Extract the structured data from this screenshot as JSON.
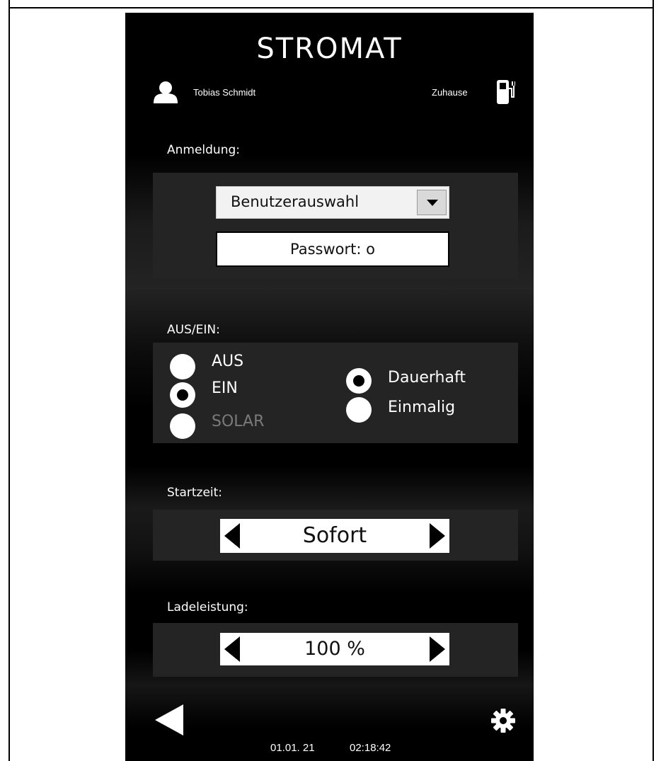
{
  "header": {
    "logo": "STROMAT",
    "user_name": "Tobias Schmidt",
    "location": "Zuhause"
  },
  "login": {
    "label": "Anmeldung:",
    "user_select_value": "Benutzerauswahl",
    "password_text": "Passwort: o"
  },
  "mode": {
    "label": "AUS/EIN:",
    "options": [
      {
        "label": "AUS",
        "checked": false,
        "disabled": false
      },
      {
        "label": "EIN",
        "checked": true,
        "disabled": false
      },
      {
        "label": "SOLAR",
        "checked": false,
        "disabled": true
      }
    ],
    "duration_options": [
      {
        "label": "Dauerhaft",
        "checked": true
      },
      {
        "label": "Einmalig",
        "checked": false
      }
    ]
  },
  "start_time": {
    "label": "Startzeit:",
    "value": "Sofort"
  },
  "charge_power": {
    "label": "Ladeleistung:",
    "value": "100 %"
  },
  "footer": {
    "date": "01.01. 21",
    "time": "02:18:42"
  },
  "icons": {
    "user": "user-icon",
    "charger": "charging-station-icon",
    "back": "back-arrow-icon",
    "settings": "gear-icon"
  }
}
